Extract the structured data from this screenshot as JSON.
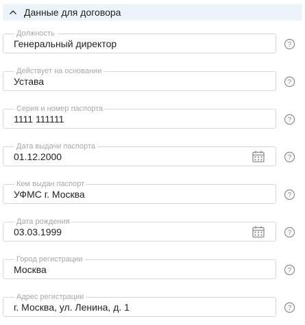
{
  "section": {
    "title": "Данные для договора",
    "toggle_icon": "chevron-up-icon"
  },
  "fields": [
    {
      "label": "Должность",
      "value": "Генеральный директор",
      "has_calendar": false
    },
    {
      "label": "Действует на основании",
      "value": "Устава",
      "has_calendar": false
    },
    {
      "label": "Серия и номер паспорта",
      "value": "1111 111111",
      "has_calendar": false
    },
    {
      "label": "Дата выдачи паспорта",
      "value": "01.12.2000",
      "has_calendar": true
    },
    {
      "label": "Кем выдан паспорт",
      "value": "УФМС г. Москва",
      "has_calendar": false
    },
    {
      "label": "Дата рождения",
      "value": "03.03.1999",
      "has_calendar": true
    },
    {
      "label": "Город регистрации",
      "value": "Москва",
      "has_calendar": false
    },
    {
      "label": "Адрес регистрации",
      "value": "г. Москва, ул. Ленина, д. 1",
      "has_calendar": false
    }
  ],
  "icons": {
    "help": "question-circle-icon",
    "calendar": "calendar-icon"
  },
  "colors": {
    "header_bg": "#edf3fb",
    "field_border": "#d6d6d6",
    "label": "#a7a7a7",
    "icon": "#8a8a8a"
  }
}
